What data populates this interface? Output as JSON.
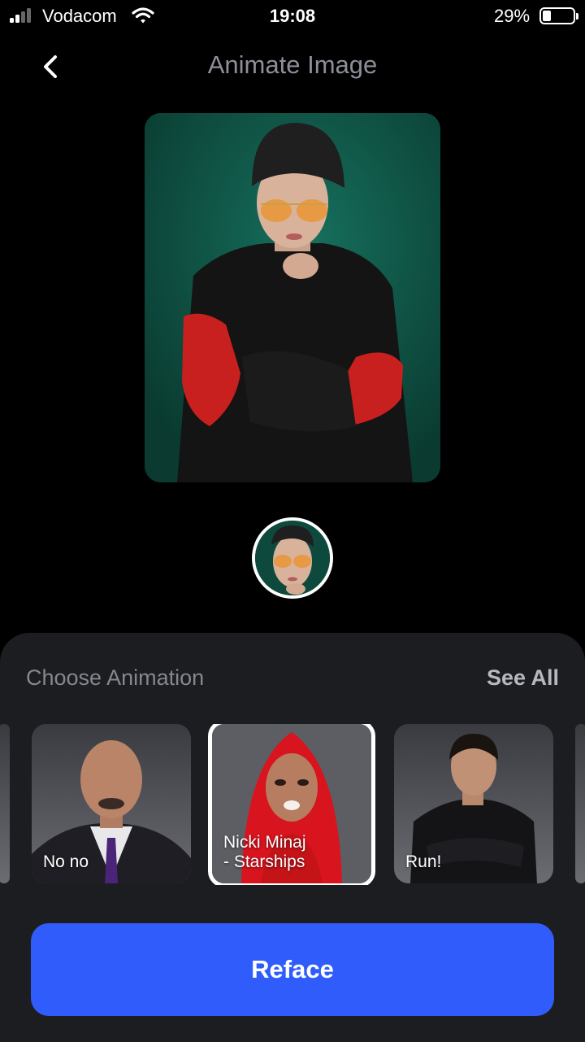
{
  "status_bar": {
    "carrier": "Vodacom",
    "time": "19:08",
    "battery_percent": "29%",
    "battery_level": 0.29,
    "icons": [
      "cellular-signal-icon",
      "wifi-icon",
      "battery-icon"
    ]
  },
  "header": {
    "title": "Animate Image",
    "back_icon": "chevron-left-icon"
  },
  "main": {
    "photo": "portrait-photo",
    "face_thumb": "face-avatar"
  },
  "animations": {
    "section_title": "Choose Animation",
    "see_all_label": "See All",
    "items": [
      {
        "label": "",
        "selected": false
      },
      {
        "label": "No no",
        "selected": false
      },
      {
        "label": "Nicki Minaj\n- Starships",
        "selected": true
      },
      {
        "label": "Run!",
        "selected": false
      },
      {
        "label": "",
        "selected": false
      }
    ]
  },
  "action": {
    "button_label": "Reface"
  },
  "colors": {
    "background": "#000000",
    "panel": "#1c1d21",
    "accent": "#2f5cfb",
    "photo_backdrop": "#0d4a3d"
  }
}
